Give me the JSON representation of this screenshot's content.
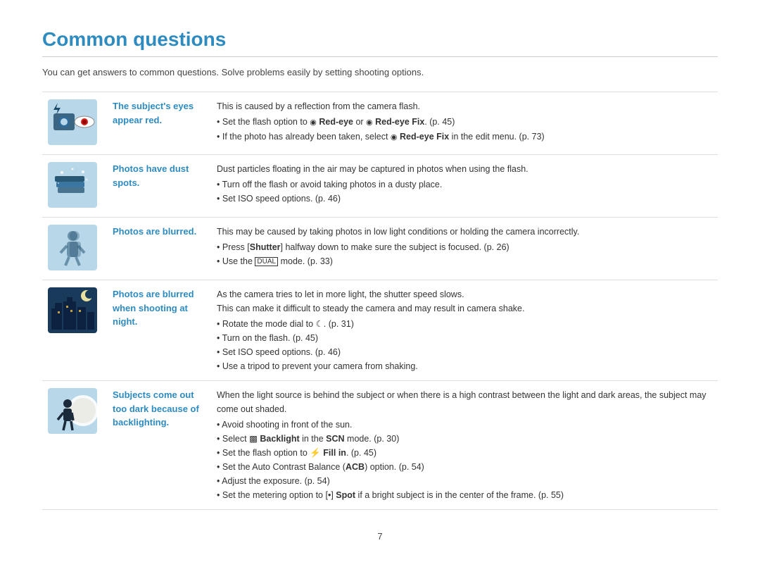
{
  "page": {
    "title": "Common questions",
    "subtitle": "You can get answers to common questions. Solve problems easily by setting shooting options.",
    "page_number": "7"
  },
  "rows": [
    {
      "id": "red-eye",
      "label": "The subject's eyes appear red.",
      "description_intro": "This is caused by a reflection from the camera flash.",
      "bullets": [
        {
          "text": "Set the flash option to ",
          "highlight": "Red-eye",
          "highlight2": " or ",
          "highlight3": "Red-eye Fix",
          "suffix": ". (p. 45)"
        },
        {
          "text": "If the photo has already been taken, select ",
          "highlight": "Red-eye Fix",
          "suffix": " in the edit menu. (p. 73)"
        }
      ],
      "raw_bullets": [
        "Set the flash option to 🔴 Red-eye or 🔴 Red-eye Fix. (p. 45)",
        "If the photo has already been taken, select 🔴 Red-eye Fix in the edit menu. (p. 73)"
      ]
    },
    {
      "id": "dust",
      "label": "Photos have dust spots.",
      "description_intro": "Dust particles floating in the air may be captured in photos when using the flash.",
      "raw_bullets": [
        "Turn off the flash or avoid taking photos in a dusty place.",
        "Set ISO speed options. (p. 46)"
      ]
    },
    {
      "id": "blurred",
      "label": "Photos are blurred.",
      "description_intro": "This may be caused by taking photos in low light conditions or holding the camera incorrectly.",
      "raw_bullets": [
        "Press [Shutter] halfway down to make sure the subject is focused. (p. 26)",
        "Use the DUAL mode. (p. 33)"
      ]
    },
    {
      "id": "night",
      "label": "Photos are blurred when shooting at night.",
      "description_intro": "As the camera tries to let in more light, the shutter speed slows.\nThis can make it difficult to steady the camera and may result in camera shake.",
      "raw_bullets": [
        "Rotate the mode dial to 🌙. (p. 31)",
        "Turn on the flash. (p. 45)",
        "Set ISO speed options. (p. 46)",
        "Use a tripod to prevent your camera from shaking."
      ]
    },
    {
      "id": "backlight",
      "label": "Subjects come out too dark because of backlighting.",
      "description_intro": "When the light source is behind the subject or when there is a high contrast between the light and dark areas, the subject may come out shaded.",
      "raw_bullets": [
        "Avoid shooting in front of the sun.",
        "Select 🔲 Backlight in the SCN mode. (p. 30)",
        "Set the flash option to ⚡ Fill in. (p. 45)",
        "Set the Auto Contrast Balance (ACB) option. (p. 54)",
        "Adjust the exposure. (p. 54)",
        "Set the metering option to [•] Spot if a bright subject is in the center of the frame. (p. 55)"
      ]
    }
  ]
}
